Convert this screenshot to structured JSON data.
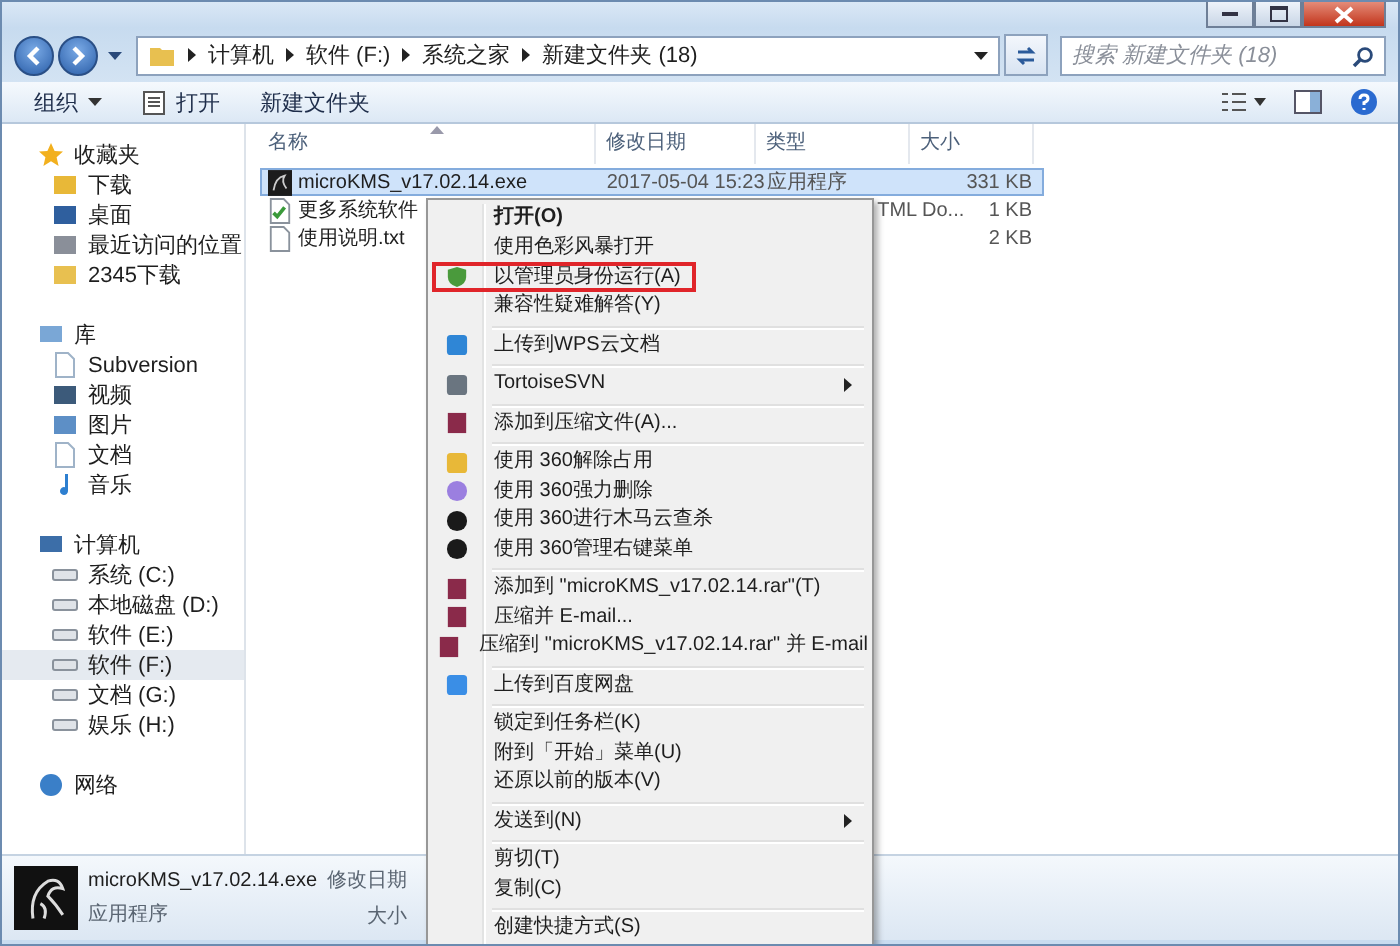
{
  "address": {
    "path": [
      "计算机",
      "软件 (F:)",
      "系统之家",
      "新建文件夹 (18)"
    ],
    "search": {
      "placeholder": "搜索 新建文件夹 (18)"
    }
  },
  "toolbar": {
    "buttons": [
      {
        "label": "组织",
        "kind": "menu"
      },
      {
        "label": "打开",
        "kind": "open"
      },
      {
        "label": "新建文件夹",
        "kind": "plain"
      }
    ]
  },
  "sidebar": {
    "groups": [
      {
        "label": "收藏夹",
        "kind": "star",
        "selected": false,
        "children": [
          {
            "label": "下载",
            "kind": "download",
            "selected": false
          },
          {
            "label": "桌面",
            "kind": "desktop",
            "selected": false
          },
          {
            "label": "最近访问的位置",
            "kind": "recent",
            "selected": false
          },
          {
            "label": "2345下载",
            "kind": "folder",
            "selected": false
          }
        ]
      },
      {
        "label": "库",
        "kind": "library",
        "selected": false,
        "children": [
          {
            "label": "Subversion",
            "kind": "doc",
            "selected": false
          },
          {
            "label": "视频",
            "kind": "video",
            "selected": false
          },
          {
            "label": "图片",
            "kind": "picture",
            "selected": false
          },
          {
            "label": "文档",
            "kind": "doc",
            "selected": false
          },
          {
            "label": "音乐",
            "kind": "music",
            "selected": false
          }
        ]
      },
      {
        "label": "计算机",
        "kind": "computer",
        "selected": false,
        "children": [
          {
            "label": "系统 (C:)",
            "kind": "drive",
            "selected": false
          },
          {
            "label": "本地磁盘 (D:)",
            "kind": "drive",
            "selected": false
          },
          {
            "label": "软件 (E:)",
            "kind": "drive",
            "selected": false
          },
          {
            "label": "软件 (F:)",
            "kind": "drive",
            "selected": true
          },
          {
            "label": "文档 (G:)",
            "kind": "drive",
            "selected": false
          },
          {
            "label": "娱乐 (H:)",
            "kind": "drive",
            "selected": false
          }
        ]
      },
      {
        "label": "网络",
        "kind": "network",
        "selected": false
      }
    ]
  },
  "files": {
    "columns": [
      "名称",
      "修改日期",
      "类型",
      "大小"
    ],
    "rows": [
      {
        "name": "microKMS_v17.02.14.exe",
        "date": "2017-05-04 15:23",
        "type": "应用程序",
        "size": "331 KB",
        "kind": "exe",
        "selected": true
      },
      {
        "name": "更多系统软件",
        "type": "TML Do...",
        "size": "1 KB",
        "kind": "html",
        "selected": false
      },
      {
        "name": "使用说明.txt",
        "size": "2 KB",
        "kind": "txt",
        "selected": false
      }
    ]
  },
  "context_menu": {
    "items": [
      {
        "kind": "plain",
        "label": "打开(O)",
        "default": true,
        "outlined": false
      },
      {
        "kind": "plain",
        "label": "使用色彩风暴打开",
        "default": false,
        "outlined": false
      },
      {
        "kind": "shield",
        "label": "以管理员身份运行(A)",
        "default": false,
        "outlined": true
      },
      {
        "kind": "plain",
        "label": "兼容性疑难解答(Y)",
        "default": false,
        "outlined": false
      },
      {
        "kind": "separator"
      },
      {
        "kind": "wps",
        "label": "上传到WPS云文档",
        "default": false,
        "outlined": false
      },
      {
        "kind": "separator"
      },
      {
        "kind": "svn",
        "label": "TortoiseSVN",
        "default": false,
        "outlined": false,
        "submenu": true
      },
      {
        "kind": "separator"
      },
      {
        "kind": "archive",
        "label": "添加到压缩文件(A)...",
        "default": false,
        "outlined": false
      },
      {
        "kind": "separator"
      },
      {
        "kind": "unlock",
        "label": "使用 360解除占用",
        "default": false,
        "outlined": false
      },
      {
        "kind": "erase",
        "label": "使用 360强力删除",
        "default": false,
        "outlined": false
      },
      {
        "kind": "scan",
        "label": "使用 360进行木马云查杀",
        "default": false,
        "outlined": false
      },
      {
        "kind": "scan",
        "label": "使用 360管理右键菜单",
        "default": false,
        "outlined": false
      },
      {
        "kind": "separator"
      },
      {
        "kind": "archive",
        "label": "添加到 \"microKMS_v17.02.14.rar\"(T)",
        "default": false,
        "outlined": false
      },
      {
        "kind": "archive",
        "label": "压缩并 E-mail...",
        "default": false,
        "outlined": false
      },
      {
        "kind": "archive",
        "label": "压缩到 \"microKMS_v17.02.14.rar\" 并 E-mail",
        "default": false,
        "outlined": false
      },
      {
        "kind": "separator"
      },
      {
        "kind": "cloud",
        "label": "上传到百度网盘",
        "default": false,
        "outlined": false
      },
      {
        "kind": "separator"
      },
      {
        "kind": "plain",
        "label": "锁定到任务栏(K)",
        "default": false,
        "outlined": false
      },
      {
        "kind": "plain",
        "label": "附到「开始」菜单(U)",
        "default": false,
        "outlined": false
      },
      {
        "kind": "plain",
        "label": "还原以前的版本(V)",
        "default": false,
        "outlined": false
      },
      {
        "kind": "separator"
      },
      {
        "kind": "plain",
        "label": "发送到(N)",
        "default": false,
        "outlined": false,
        "submenu": true
      },
      {
        "kind": "separator"
      },
      {
        "kind": "plain",
        "label": "剪切(T)",
        "default": false,
        "outlined": false
      },
      {
        "kind": "plain",
        "label": "复制(C)",
        "default": false,
        "outlined": false
      },
      {
        "kind": "separator"
      },
      {
        "kind": "plain",
        "label": "创建快捷方式(S)",
        "default": false,
        "outlined": false
      }
    ]
  },
  "details": {
    "name": "microKMS_v17.02.14.exe",
    "type": "应用程序",
    "date_label": "修改日期",
    "size_label": "大小"
  }
}
